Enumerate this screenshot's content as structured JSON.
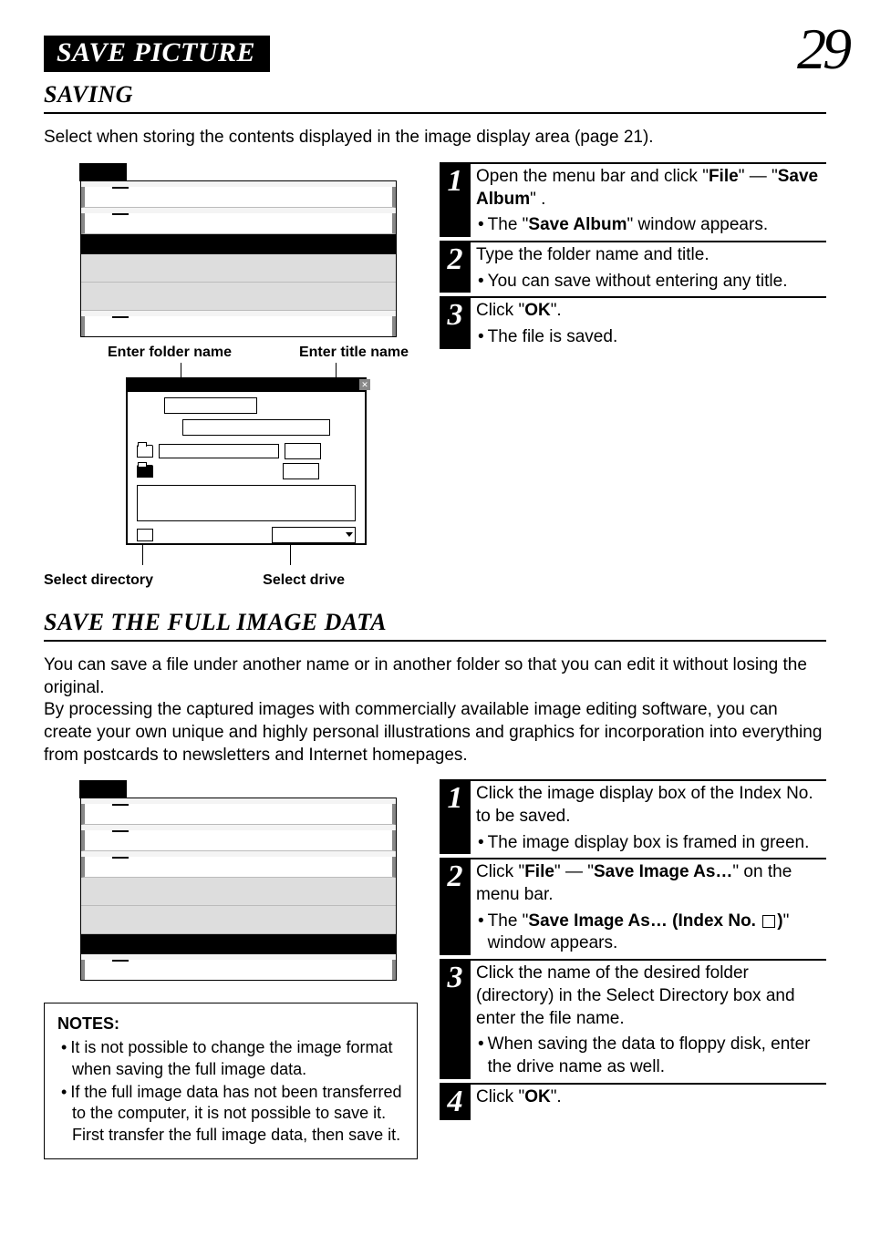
{
  "page_number": "29",
  "header": {
    "title": "SAVE PICTURE"
  },
  "section1": {
    "heading": "SAVING",
    "intro": "Select when storing the contents displayed in the image display area (page 21).",
    "callouts": {
      "folder_label": "Enter folder name",
      "title_label": "Enter title name",
      "directory_label": "Select directory",
      "drive_label": "Select drive"
    },
    "steps": [
      {
        "num": "1",
        "parts": [
          {
            "pre": "Open the menu bar and click \"",
            "bold": "File",
            "post": "\" — "
          },
          {
            "pre": "\"",
            "bold": "Save Album",
            "post": "\" ."
          }
        ],
        "bullet": {
          "pre": "The \"",
          "bold": "Save Album",
          "post": "\" window appears."
        }
      },
      {
        "num": "2",
        "line": "Type the folder name and title.",
        "bullet": {
          "text": "You can save without entering any title."
        }
      },
      {
        "num": "3",
        "parts": [
          {
            "pre": "Click \"",
            "bold": "OK",
            "post": "\"."
          }
        ],
        "bullet": {
          "text": "The file is saved."
        }
      }
    ]
  },
  "section2": {
    "heading": "SAVE THE FULL IMAGE DATA",
    "intro": "You can save a file under another name or in another folder so that you can edit it without losing the original.\nBy processing the captured images with commercially available image editing software, you can create your own unique and highly personal illustrations and graphics for incorporation into everything from postcards to newsletters and Internet homepages.",
    "notes": {
      "title": "NOTES:",
      "items": [
        "It is not possible to change the image format when saving the full image data.",
        "If the full image data has not been transferred to the computer, it is not possible to save it.  First transfer the full image data, then save it."
      ]
    },
    "steps": [
      {
        "num": "1",
        "line": "Click the image display box of the Index No. to be saved.",
        "bullet": {
          "text": "The image display box is framed in green."
        }
      },
      {
        "num": "2",
        "parts": [
          {
            "pre": "Click \"",
            "bold": "File",
            "post": "\" — \""
          },
          {
            "bold": "Save Image As…",
            "post": "\" on the menu bar."
          }
        ],
        "bullet": {
          "pre": "The \"",
          "bold": "Save Image As… (Index No.",
          "square": true,
          "bold2": ")",
          "post": "\" window appears."
        }
      },
      {
        "num": "3",
        "line": "Click the name of the desired folder (directory) in the Select Directory box and enter the file name.",
        "bullet": {
          "text": "When saving the data to floppy disk, enter the drive name as well."
        }
      },
      {
        "num": "4",
        "parts": [
          {
            "pre": "Click \"",
            "bold": "OK",
            "post": "\"."
          }
        ]
      }
    ]
  }
}
